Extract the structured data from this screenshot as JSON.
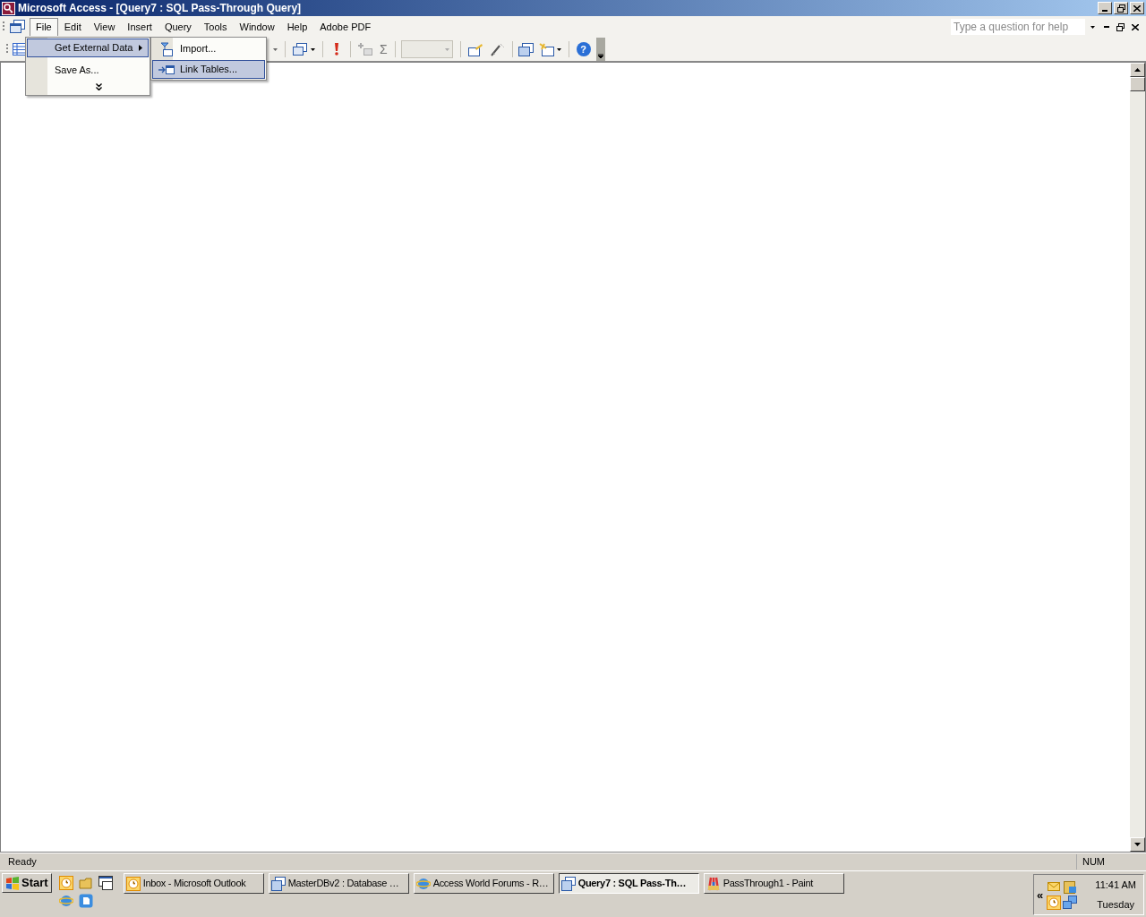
{
  "window": {
    "title": "Microsoft Access - [Query7 : SQL Pass-Through Query]"
  },
  "menu_bar": {
    "items": [
      {
        "label": "File",
        "selected": true
      },
      {
        "label": "Edit",
        "selected": false
      },
      {
        "label": "View",
        "selected": false
      },
      {
        "label": "Insert",
        "selected": false
      },
      {
        "label": "Query",
        "selected": false
      },
      {
        "label": "Tools",
        "selected": false
      },
      {
        "label": "Window",
        "selected": false
      },
      {
        "label": "Help",
        "selected": false
      },
      {
        "label": "Adobe PDF",
        "selected": false
      }
    ]
  },
  "help_search": {
    "placeholder": "Type a question for help"
  },
  "toolbar": {
    "totals_symbol": "Σ",
    "help_symbol": "?"
  },
  "file_menu": {
    "items": [
      {
        "kind": "submenu",
        "label": "Get External Data",
        "selected": true
      },
      {
        "kind": "command",
        "label": "Save As...",
        "selected": false
      },
      {
        "kind": "expand",
        "selected": false
      }
    ]
  },
  "external_data_submenu": {
    "items": [
      {
        "label": "Import...",
        "selected": false
      },
      {
        "label": "Link Tables...",
        "selected": true
      }
    ]
  },
  "status_bar": {
    "text": "Ready",
    "indicators": [
      "NUM"
    ]
  },
  "taskbar": {
    "start": "Start",
    "buttons": [
      {
        "label": "Inbox - Microsoft Outlook",
        "selected": false
      },
      {
        "label": "MasterDBv2 : Database …",
        "selected": false
      },
      {
        "label": "Access World Forums - R…",
        "selected": false
      },
      {
        "label": "Query7 : SQL Pass-Th…",
        "selected": true
      },
      {
        "label": "PassThrough1 - Paint",
        "selected": false
      }
    ],
    "tray_toggle": "«",
    "clock": {
      "time": "11:41 AM",
      "day": "Tuesday"
    }
  }
}
